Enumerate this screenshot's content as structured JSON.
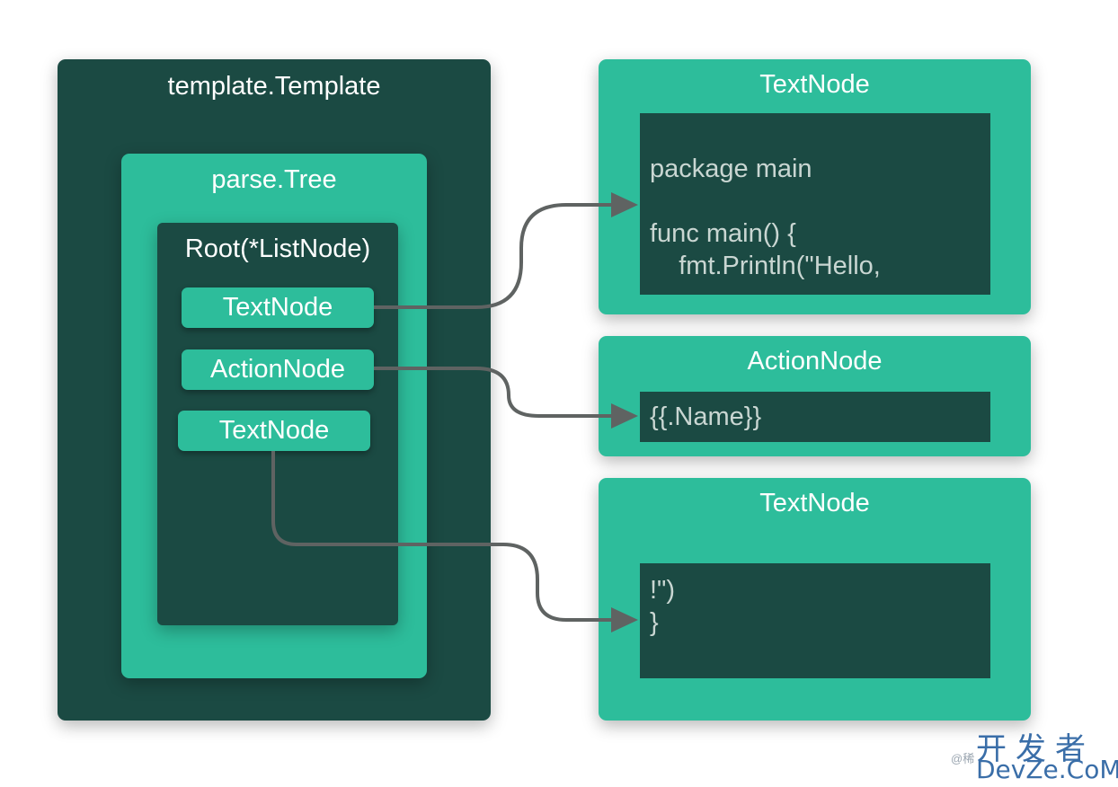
{
  "left": {
    "template_title": "template.Template",
    "tree_title": "parse.Tree",
    "root_title": "Root(*ListNode)",
    "nodes": [
      {
        "label": "TextNode"
      },
      {
        "label": "ActionNode"
      },
      {
        "label": "TextNode"
      }
    ]
  },
  "right": {
    "panels": [
      {
        "title": "TextNode",
        "code": [
          "",
          "package main",
          "",
          "func main() {",
          "    fmt.Println(\"Hello,"
        ]
      },
      {
        "title": "ActionNode",
        "code": [
          "{{.Name}}"
        ]
      },
      {
        "title": "TextNode",
        "code": [
          "",
          "!\")",
          "}"
        ]
      }
    ]
  },
  "colors": {
    "dark": "#1b4a43",
    "teal": "#2dbd9b",
    "arrow": "#5f6362"
  },
  "watermark": {
    "cn": "开发者",
    "en": "DevZe.CoM",
    "at": "@稀"
  }
}
